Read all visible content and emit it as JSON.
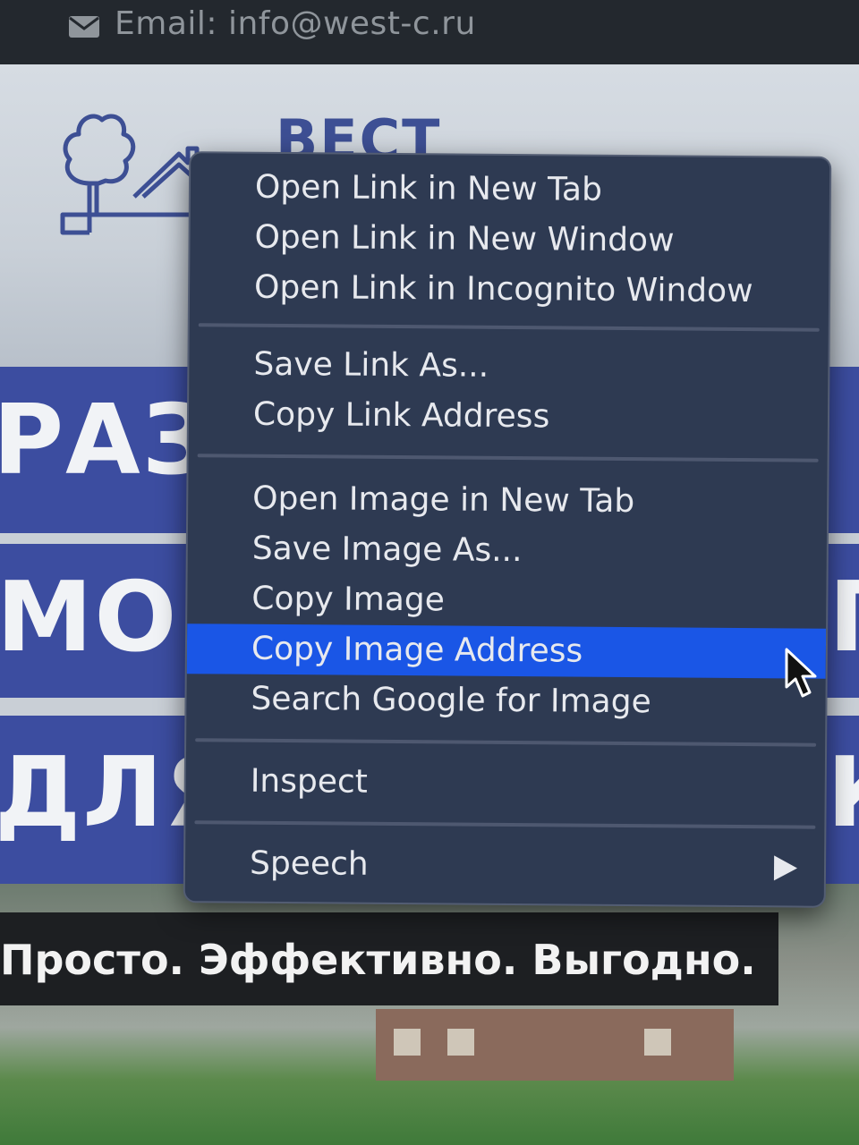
{
  "topbar": {
    "email": "Email: info@west-c.ru",
    "icon": "mail-icon"
  },
  "header": {
    "logo_text": "ВЕСТ"
  },
  "banners": {
    "line1_left": "РАЗ",
    "line2_left": "МО",
    "line2_right": "П",
    "line3_left": "ДЛЯ",
    "line3_right": "К"
  },
  "slogan": "Просто. Эффективно. Выгодно.",
  "context_menu": {
    "groups": [
      [
        "Open Link in New Tab",
        "Open Link in New Window",
        "Open Link in Incognito Window"
      ],
      [
        "Save Link As...",
        "Copy Link Address"
      ],
      [
        "Open Image in New Tab",
        "Save Image As...",
        "Copy Image",
        "Copy Image Address",
        "Search Google for Image"
      ],
      [
        "Inspect"
      ],
      [
        "Speech"
      ]
    ],
    "highlighted": "Copy Image Address",
    "highlight_color": "#1a56e6",
    "submenu_item": "Speech"
  },
  "colors": {
    "menu_bg": "#2e3a52",
    "banner_blue": "#3c4da0",
    "topbar_bg": "#23282e"
  }
}
